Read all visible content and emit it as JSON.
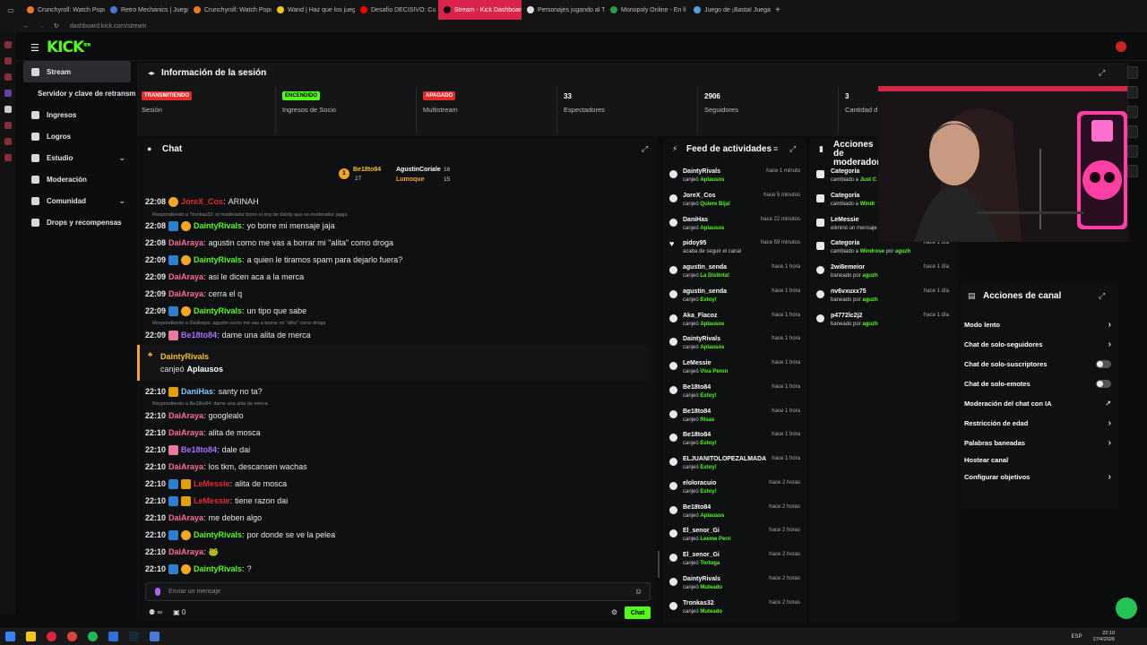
{
  "browser": {
    "tabs": [
      {
        "label": "Crunchyroll: Watch Popu",
        "color": "#f47521"
      },
      {
        "label": "Retro Mechanics | Juego",
        "color": "#4a79d9"
      },
      {
        "label": "Crunchyroll: Watch Popu",
        "color": "#f47521"
      },
      {
        "label": "Wand | Haz que los juego",
        "color": "#f5c518"
      },
      {
        "label": "Desafío DECISIVO: Cu",
        "color": "#ff0000"
      },
      {
        "label": "Stream - Kick Dashboard",
        "color": "#53fc18",
        "active": true
      },
      {
        "label": "Personajes jugando al Tu",
        "color": "#dddddd"
      },
      {
        "label": "Monopoly Online - En lí",
        "color": "#2a9d4b"
      },
      {
        "label": "Juego de ¡Basta! Juega S",
        "color": "#4aa3df"
      }
    ],
    "address": "dashboard.kick.com/stream"
  },
  "app": {
    "logo": "KICK",
    "logo_sup": "BETA"
  },
  "nav": {
    "items": [
      {
        "label": "Stream",
        "active": true
      },
      {
        "label": "Servidor y clave de retransm"
      },
      {
        "label": "Ingresos"
      },
      {
        "label": "Logros"
      },
      {
        "label": "Estudio",
        "chevron": true
      },
      {
        "label": "Moderación"
      },
      {
        "label": "Comunidad",
        "chevron": true
      },
      {
        "label": "Drops y recompensas"
      }
    ]
  },
  "session": {
    "title": "Información de la sesión",
    "cards": [
      {
        "badge": "TRANSMITIENDO",
        "badge_color": "#e62b2b",
        "label": "Sesión"
      },
      {
        "badge": "ENCENDIDO",
        "badge_color": "#53fc18",
        "label": "Ingresos de Socio"
      },
      {
        "badge": "APAGADO",
        "badge_color": "#e62b2b",
        "label": "Multistream"
      },
      {
        "value": "33",
        "label": "Espectadores"
      },
      {
        "value": "2906",
        "label": "Seguidores"
      },
      {
        "value": "3",
        "label": "Cantidad d"
      }
    ]
  },
  "chat": {
    "title": "Chat",
    "leaderboard": [
      {
        "name": "Be18to84",
        "count1": "27",
        "rank": "1"
      },
      {
        "name": "AgustinCoriale",
        "count1": "16"
      },
      {
        "name": "Lumoque",
        "count1": "15"
      }
    ],
    "messages": [
      {
        "time": "22:08",
        "badges": [
          "sub"
        ],
        "user": "JoreX_Cos",
        "color": "#e62b2b",
        "text": "ARINAH"
      },
      {
        "reply": "Respondiendo a Tronkas32: el moderador borro el msj de dainty que es moderador jajaja"
      },
      {
        "time": "22:08",
        "badges": [
          "mod",
          "sub"
        ],
        "user": "DaintyRivals",
        "color": "#53fc18",
        "text": "yo borre mi mensaje jaja"
      },
      {
        "time": "22:08",
        "badges": [],
        "user": "DaiAraya",
        "color": "#ff6b9a",
        "text": "agustin como me vas a borrar mi \"alita\" como droga"
      },
      {
        "time": "22:09",
        "badges": [
          "mod",
          "sub"
        ],
        "user": "DaintyRivals",
        "color": "#53fc18",
        "text": "a quien le tiramos spam para dejarlo fuera?"
      },
      {
        "time": "22:09",
        "badges": [],
        "user": "DaiAraya",
        "color": "#ff6b9a",
        "text": "asi le dicen aca a la merca"
      },
      {
        "time": "22:09",
        "badges": [],
        "user": "DaiAraya",
        "color": "#ff6b9a",
        "text": "cerra el q"
      },
      {
        "time": "22:09",
        "badges": [
          "mod",
          "sub"
        ],
        "user": "DaintyRivals",
        "color": "#53fc18",
        "text": "un tipo que sabe"
      },
      {
        "reply": "Respondiendo a DaiAraya: agustin como me vas a borrar mi \"alita\" como droga"
      },
      {
        "time": "22:09",
        "badges": [
          "gift"
        ],
        "user": "Be18to84",
        "color": "#a970ff",
        "text": "dame una alita de merca"
      },
      {
        "redeem": true,
        "user": "DaintyRivals",
        "pre": "canjeó",
        "reward": "Aplausos"
      },
      {
        "time": "22:10",
        "badges": [
          "vip"
        ],
        "user": "DaniHas",
        "color": "#7ec8ff",
        "text": "santy no ta?"
      },
      {
        "reply": "Respondiendo a Be18to84: dame una alita de merca"
      },
      {
        "time": "22:10",
        "badges": [],
        "user": "DaiAraya",
        "color": "#ff6b9a",
        "text": "googlealo"
      },
      {
        "time": "22:10",
        "badges": [],
        "user": "DaiAraya",
        "color": "#ff6b9a",
        "text": "alita de mosca"
      },
      {
        "time": "22:10",
        "badges": [
          "gift"
        ],
        "user": "Be18to84",
        "color": "#a970ff",
        "text": "dale dai"
      },
      {
        "time": "22:10",
        "badges": [],
        "user": "DaiAraya",
        "color": "#ff6b9a",
        "text": "los tkm, descansen wachas"
      },
      {
        "time": "22:10",
        "badges": [
          "mod",
          "vip"
        ],
        "user": "LeMessie",
        "color": "#e62b2b",
        "text": "alita de mosca"
      },
      {
        "time": "22:10",
        "badges": [
          "mod",
          "vip"
        ],
        "user": "LeMessie",
        "color": "#e62b2b",
        "text": "tiene razon dai"
      },
      {
        "time": "22:10",
        "badges": [],
        "user": "DaiAraya",
        "color": "#ff6b9a",
        "text": "me deben algo"
      },
      {
        "time": "22:10",
        "badges": [
          "mod",
          "sub"
        ],
        "user": "DaintyRivals",
        "color": "#53fc18",
        "text": "por donde se ve la pelea"
      },
      {
        "time": "22:10",
        "badges": [],
        "user": "DaiAraya",
        "color": "#ff6b9a",
        "text": "🐸"
      },
      {
        "time": "22:10",
        "badges": [
          "mod",
          "sub"
        ],
        "user": "DaintyRivals",
        "color": "#53fc18",
        "text": "?"
      }
    ],
    "input_placeholder": "Enviar un mensaje",
    "footer_infinity": "∞",
    "footer_count": "0",
    "send_label": "Chat"
  },
  "feed": {
    "title": "Feed de actividades",
    "items": [
      {
        "name": "DaintyRivals",
        "time": "hace 1 minuto",
        "pre": "canjeó",
        "reward": "Aplausos"
      },
      {
        "name": "JoreX_Cos",
        "time": "hace 5 minutos",
        "pre": "canjeó",
        "reward": "Quiere Bija!"
      },
      {
        "name": "DaniHas",
        "time": "hace 22 minutos",
        "pre": "canjeó",
        "reward": "Aplausos"
      },
      {
        "name": "pidoy95",
        "time": "hace 59 minutos",
        "pre": "acaba de seguir el canal",
        "reward": "",
        "icon": "heart"
      },
      {
        "name": "agustin_senda",
        "time": "hace 1 hora",
        "pre": "canjeó",
        "reward": "La Distinta!"
      },
      {
        "name": "agustin_senda",
        "time": "hace 1 hora",
        "pre": "canjeó",
        "reward": "Estoy!"
      },
      {
        "name": "Aka_Flacoz",
        "time": "hace 1 hora",
        "pre": "canjeó",
        "reward": "Aplausos"
      },
      {
        "name": "DaintyRivals",
        "time": "hace 1 hora",
        "pre": "canjeó",
        "reward": "Aplausos"
      },
      {
        "name": "LeMessie",
        "time": "hace 1 hora",
        "pre": "canjeó",
        "reward": "Viva Peron"
      },
      {
        "name": "Be18to84",
        "time": "hace 1 hora",
        "pre": "canjeó",
        "reward": "Estoy!"
      },
      {
        "name": "Be18to84",
        "time": "hace 1 hora",
        "pre": "canjeó",
        "reward": "Risas"
      },
      {
        "name": "Be18to84",
        "time": "hace 1 hora",
        "pre": "canjeó",
        "reward": "Estoy!"
      },
      {
        "name": "ELJUANITOLOPEZALMADA",
        "time": "hace 1 hora",
        "pre": "canjeó",
        "reward": "Estoy!"
      },
      {
        "name": "eloloracuio",
        "time": "hace 2 horas",
        "pre": "canjeó",
        "reward": "Estoy!"
      },
      {
        "name": "Be18to84",
        "time": "hace 2 horas",
        "pre": "canjeó",
        "reward": "Aplausos"
      },
      {
        "name": "El_senor_Gi",
        "time": "hace 2 horas",
        "pre": "canjeó",
        "reward": "Leeme Perri"
      },
      {
        "name": "El_senor_Gi",
        "time": "hace 2 horas",
        "pre": "canjeó",
        "reward": "Tortuga"
      },
      {
        "name": "DaintyRivals",
        "time": "hace 2 horas",
        "pre": "canjeó",
        "reward": "Muteado"
      },
      {
        "name": "Tronkas32",
        "time": "hace 2 horas",
        "pre": "canjeó",
        "reward": "Muteado"
      }
    ]
  },
  "moderation": {
    "title": "Acciones de moderador",
    "items": [
      {
        "name": "Categoría",
        "pre": "cambiado a",
        "target": "Just C",
        "time": ""
      },
      {
        "name": "Categoría",
        "pre": "cambiado a",
        "target": "Windr",
        "time": ""
      },
      {
        "name": "LeMessie",
        "pre": "eliminó un mensaje",
        "target": "",
        "time": "",
        "icon": "trash"
      },
      {
        "name": "Categoría",
        "pre": "cambiado a",
        "target": "Windrose",
        "by": "aguzh",
        "time": "hace 1 día"
      },
      {
        "name": "2wi8emeior",
        "pre": "baneado por",
        "target": "aguzh",
        "time": "hace 1 día",
        "icon": "ban"
      },
      {
        "name": "nv6vxuxx75",
        "pre": "baneado por",
        "target": "aguzh",
        "time": "hace 1 día",
        "icon": "ban"
      },
      {
        "name": "p4772lc2j2",
        "pre": "baneado por",
        "target": "aguzh",
        "time": "hace 1 día",
        "icon": "ban"
      }
    ]
  },
  "channel_actions": {
    "title": "Acciones de canal",
    "items": [
      {
        "label": "Modo lento",
        "kind": "arrow"
      },
      {
        "label": "Chat de solo-seguidores",
        "kind": "arrow"
      },
      {
        "label": "Chat de solo-suscriptores",
        "kind": "toggle"
      },
      {
        "label": "Chat de solo-emotes",
        "kind": "toggle"
      },
      {
        "label": "Moderación del chat con IA",
        "kind": "link"
      },
      {
        "label": "Restricción de edad",
        "kind": "arrow"
      },
      {
        "label": "Palabras baneadas",
        "kind": "arrow"
      },
      {
        "label": "Hostear canal",
        "kind": "none"
      },
      {
        "label": "Configurar objetivos",
        "kind": "arrow"
      }
    ]
  },
  "taskbar": {
    "lang": "ESP",
    "time": "22:10",
    "date": "17/4/2026"
  },
  "colors": {
    "accent": "#53fc18",
    "live": "#e62b2b",
    "bg": "#0b0c0d"
  }
}
